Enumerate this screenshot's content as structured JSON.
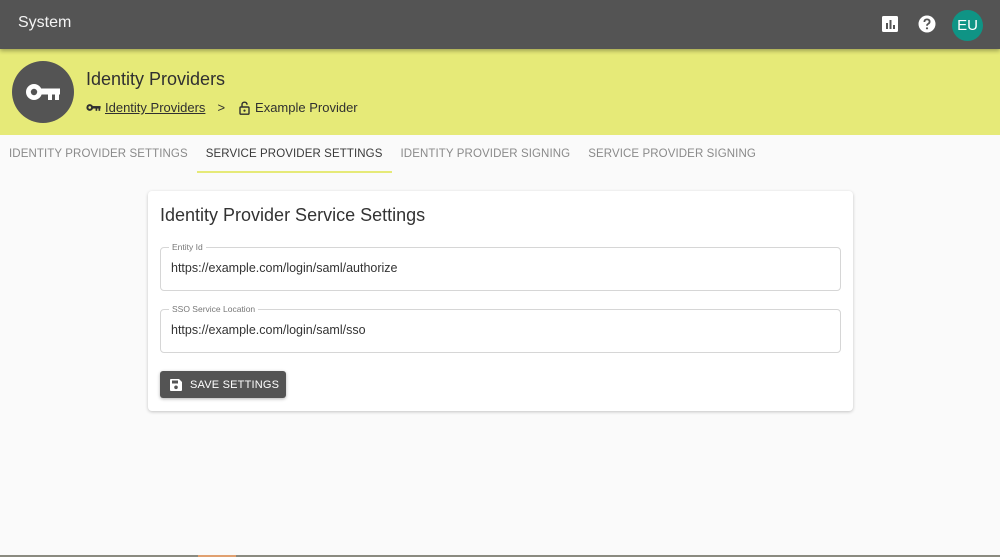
{
  "app": {
    "title": "System",
    "avatar_initials": "EU",
    "colors": {
      "topbar": "#545454",
      "accent": "#e6ea78",
      "avatar": "#0f9485"
    },
    "icons": [
      "bar-chart-icon",
      "help-icon"
    ]
  },
  "hero": {
    "heading": "Identity Providers",
    "breadcrumb": {
      "link": "Identity Providers",
      "separator": ">",
      "current": "Example Provider"
    }
  },
  "tabs": [
    {
      "label": "IDENTITY PROVIDER SETTINGS",
      "active": false
    },
    {
      "label": "SERVICE PROVIDER SETTINGS",
      "active": true
    },
    {
      "label": "IDENTITY PROVIDER SIGNING",
      "active": false
    },
    {
      "label": "SERVICE PROVIDER SIGNING",
      "active": false
    }
  ],
  "card": {
    "title": "Identity Provider Service Settings",
    "fields": [
      {
        "label": "Entity Id",
        "value": "https://example.com/login/saml/authorize"
      },
      {
        "label": "SSO Service Location",
        "value": "https://example.com/login/saml/sso"
      }
    ],
    "save_label": "SAVE SETTINGS"
  }
}
